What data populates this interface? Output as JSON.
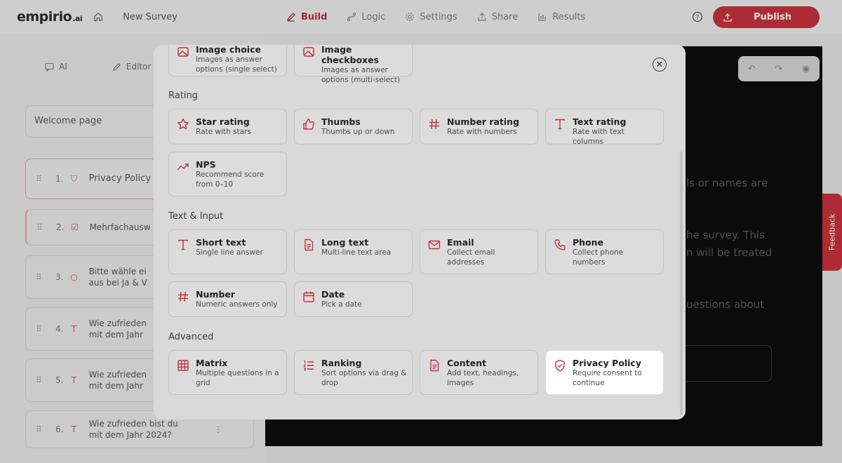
{
  "topbar": {
    "logo": "empirio",
    "logo_suffix": ".ai",
    "survey_name": "New Survey",
    "tabs": [
      {
        "label": "Build",
        "icon": "pencil-icon",
        "active": true
      },
      {
        "label": "Logic",
        "icon": "logic-icon",
        "active": false
      },
      {
        "label": "Settings",
        "icon": "gear-icon",
        "active": false
      },
      {
        "label": "Share",
        "icon": "share-icon",
        "active": false
      },
      {
        "label": "Results",
        "icon": "chart-icon",
        "active": false
      }
    ],
    "publish_label": "Publish"
  },
  "left": {
    "ai_label": "AI",
    "editor_label": "Editor",
    "welcome": "Welcome page",
    "questions": [
      {
        "num": "1.",
        "text": "Privacy Policy"
      },
      {
        "num": "2.",
        "text": "Mehrfachausw"
      },
      {
        "num": "3.",
        "text1": "Bitte wähle ei",
        "text2": "aus bei Ja & V"
      },
      {
        "num": "4.",
        "text1": "Wie zufrieden",
        "text2": "mit dem Jahr"
      },
      {
        "num": "5.",
        "text1": "Wie zufrieden",
        "text2": "mit dem Jahr"
      },
      {
        "num": "6.",
        "text1": "Wie zufrieden bist du",
        "text2": "mit dem Jahr 2024?"
      }
    ]
  },
  "preview": {
    "line1": "ls or names are",
    "line2": "he survey. This",
    "line3": "n will be treated",
    "line4": "uestions about",
    "feedback": "Feedback"
  },
  "modal": {
    "top_cards": [
      {
        "title": "Image choice",
        "desc": "Images as answer options (single select)"
      },
      {
        "title": "Image checkboxes",
        "desc": "Images as answer options (multi-select)"
      }
    ],
    "sections": [
      {
        "title": "Rating"
      },
      {
        "title": "Text & Input"
      },
      {
        "title": "Advanced"
      }
    ],
    "rating": [
      {
        "title": "Star rating",
        "desc": "Rate with stars"
      },
      {
        "title": "Thumbs",
        "desc": "Thumbs up or down"
      },
      {
        "title": "Number rating",
        "desc": "Rate with numbers"
      },
      {
        "title": "Text rating",
        "desc": "Rate with text columns"
      },
      {
        "title": "NPS",
        "desc": "Recommend score from 0–10"
      }
    ],
    "text_input": [
      {
        "title": "Short text",
        "desc": "Single line answer"
      },
      {
        "title": "Long text",
        "desc": "Multi-line text area"
      },
      {
        "title": "Email",
        "desc": "Collect email addresses"
      },
      {
        "title": "Phone",
        "desc": "Collect phone numbers"
      },
      {
        "title": "Number",
        "desc": "Numeric answers only"
      },
      {
        "title": "Date",
        "desc": "Pick a date"
      }
    ],
    "advanced": [
      {
        "title": "Matrix",
        "desc": "Multiple questions in a grid"
      },
      {
        "title": "Ranking",
        "desc": "Sort options via drag & drop"
      },
      {
        "title": "Content",
        "desc": "Add text, headings, images"
      },
      {
        "title": "Privacy Policy",
        "desc": "Require consent to continue"
      }
    ]
  },
  "colors": {
    "accent": "#c7323c",
    "icon": "#c3313b"
  }
}
